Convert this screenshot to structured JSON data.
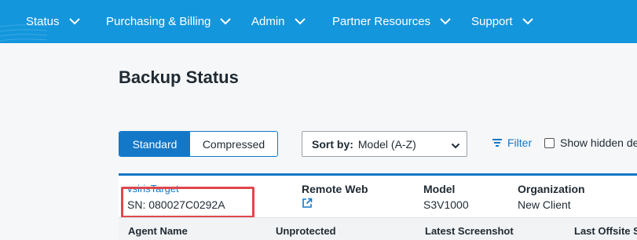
{
  "nav": {
    "items": [
      {
        "label": "Status"
      },
      {
        "label": "Purchasing & Billing"
      },
      {
        "label": "Admin"
      },
      {
        "label": "Partner Resources"
      },
      {
        "label": "Support"
      }
    ]
  },
  "page": {
    "title": "Backup Status"
  },
  "view_toggle": {
    "standard": "Standard",
    "compressed": "Compressed",
    "selected": "Standard"
  },
  "sort": {
    "label": "Sort by:",
    "value": "Model (A-Z)"
  },
  "filter": {
    "label": "Filter"
  },
  "show_hidden": {
    "label": "Show hidden de",
    "checked": false
  },
  "device": {
    "name": "vsirisTarget",
    "serial": "SN: 080027C0292A",
    "remote_web_label": "Remote Web",
    "model_label": "Model",
    "model_value": "S3V1000",
    "organization_label": "Organization",
    "organization_value": "New Client"
  },
  "agent_table": {
    "columns": [
      "Agent Name",
      "Unprotected",
      "Latest Screenshot",
      "Last Offsite S"
    ]
  },
  "colors": {
    "nav_bg": "#1496dc",
    "accent": "#1478c8",
    "highlight": "#e0474c"
  }
}
